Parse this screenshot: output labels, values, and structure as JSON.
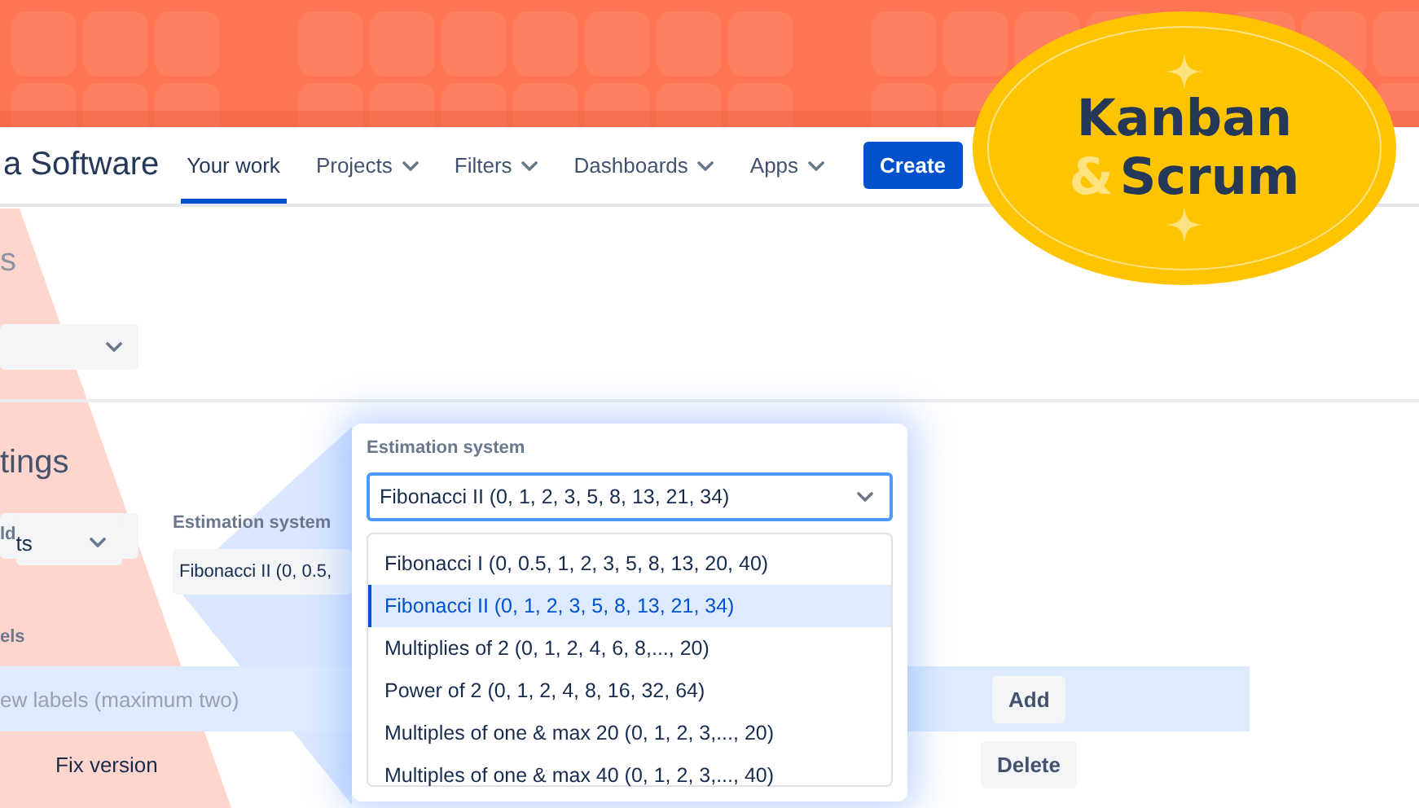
{
  "nav": {
    "logo": "a Software",
    "tabs": [
      {
        "label": "Your work",
        "selected": true,
        "dropdown": false
      },
      {
        "label": "Projects",
        "selected": false,
        "dropdown": true
      },
      {
        "label": "Filters",
        "selected": false,
        "dropdown": true
      },
      {
        "label": "Dashboards",
        "selected": false,
        "dropdown": true
      },
      {
        "label": "Apps",
        "selected": false,
        "dropdown": true
      }
    ],
    "create_button": "Create"
  },
  "badge": {
    "line1": "Kanban",
    "ampersand": "&",
    "line2": "Scrum"
  },
  "page": {
    "heading": "s"
  },
  "settings": {
    "heading": "tings",
    "fields": [
      {
        "kind": "select",
        "label": "ld",
        "value": "ts"
      },
      {
        "kind": "text",
        "label": "Estimation system",
        "value": "Fibonacci II (0, 0.5,"
      }
    ],
    "labels_label": "els",
    "labels_input": {
      "placeholder": "ew labels (maximum two)"
    },
    "add_button": "Add",
    "rows": [
      {
        "name": "Fix version",
        "button": "Delete"
      }
    ]
  },
  "popover": {
    "label": "Estimation system",
    "value": "Fibonacci II (0, 1, 2, 3, 5, 8, 13, 21, 34)",
    "options": [
      {
        "label": "Fibonacci I (0, 0.5, 1, 2, 3, 5, 8, 13, 20, 40)",
        "selected": false
      },
      {
        "label": "Fibonacci II (0, 1, 2, 3, 5, 8, 13, 21, 34)",
        "selected": true
      },
      {
        "label": "Multiplies of 2 (0, 1, 2, 4, 6, 8,..., 20)",
        "selected": false
      },
      {
        "label": "Power of 2 (0, 1, 2, 4, 8, 16, 32, 64)",
        "selected": false
      },
      {
        "label": "Multiples of one & max 20 (0, 1, 2, 3,..., 20)",
        "selected": false
      },
      {
        "label": "Multiples of one & max 40 (0, 1, 2, 3,..., 40)",
        "selected": false
      }
    ]
  }
}
